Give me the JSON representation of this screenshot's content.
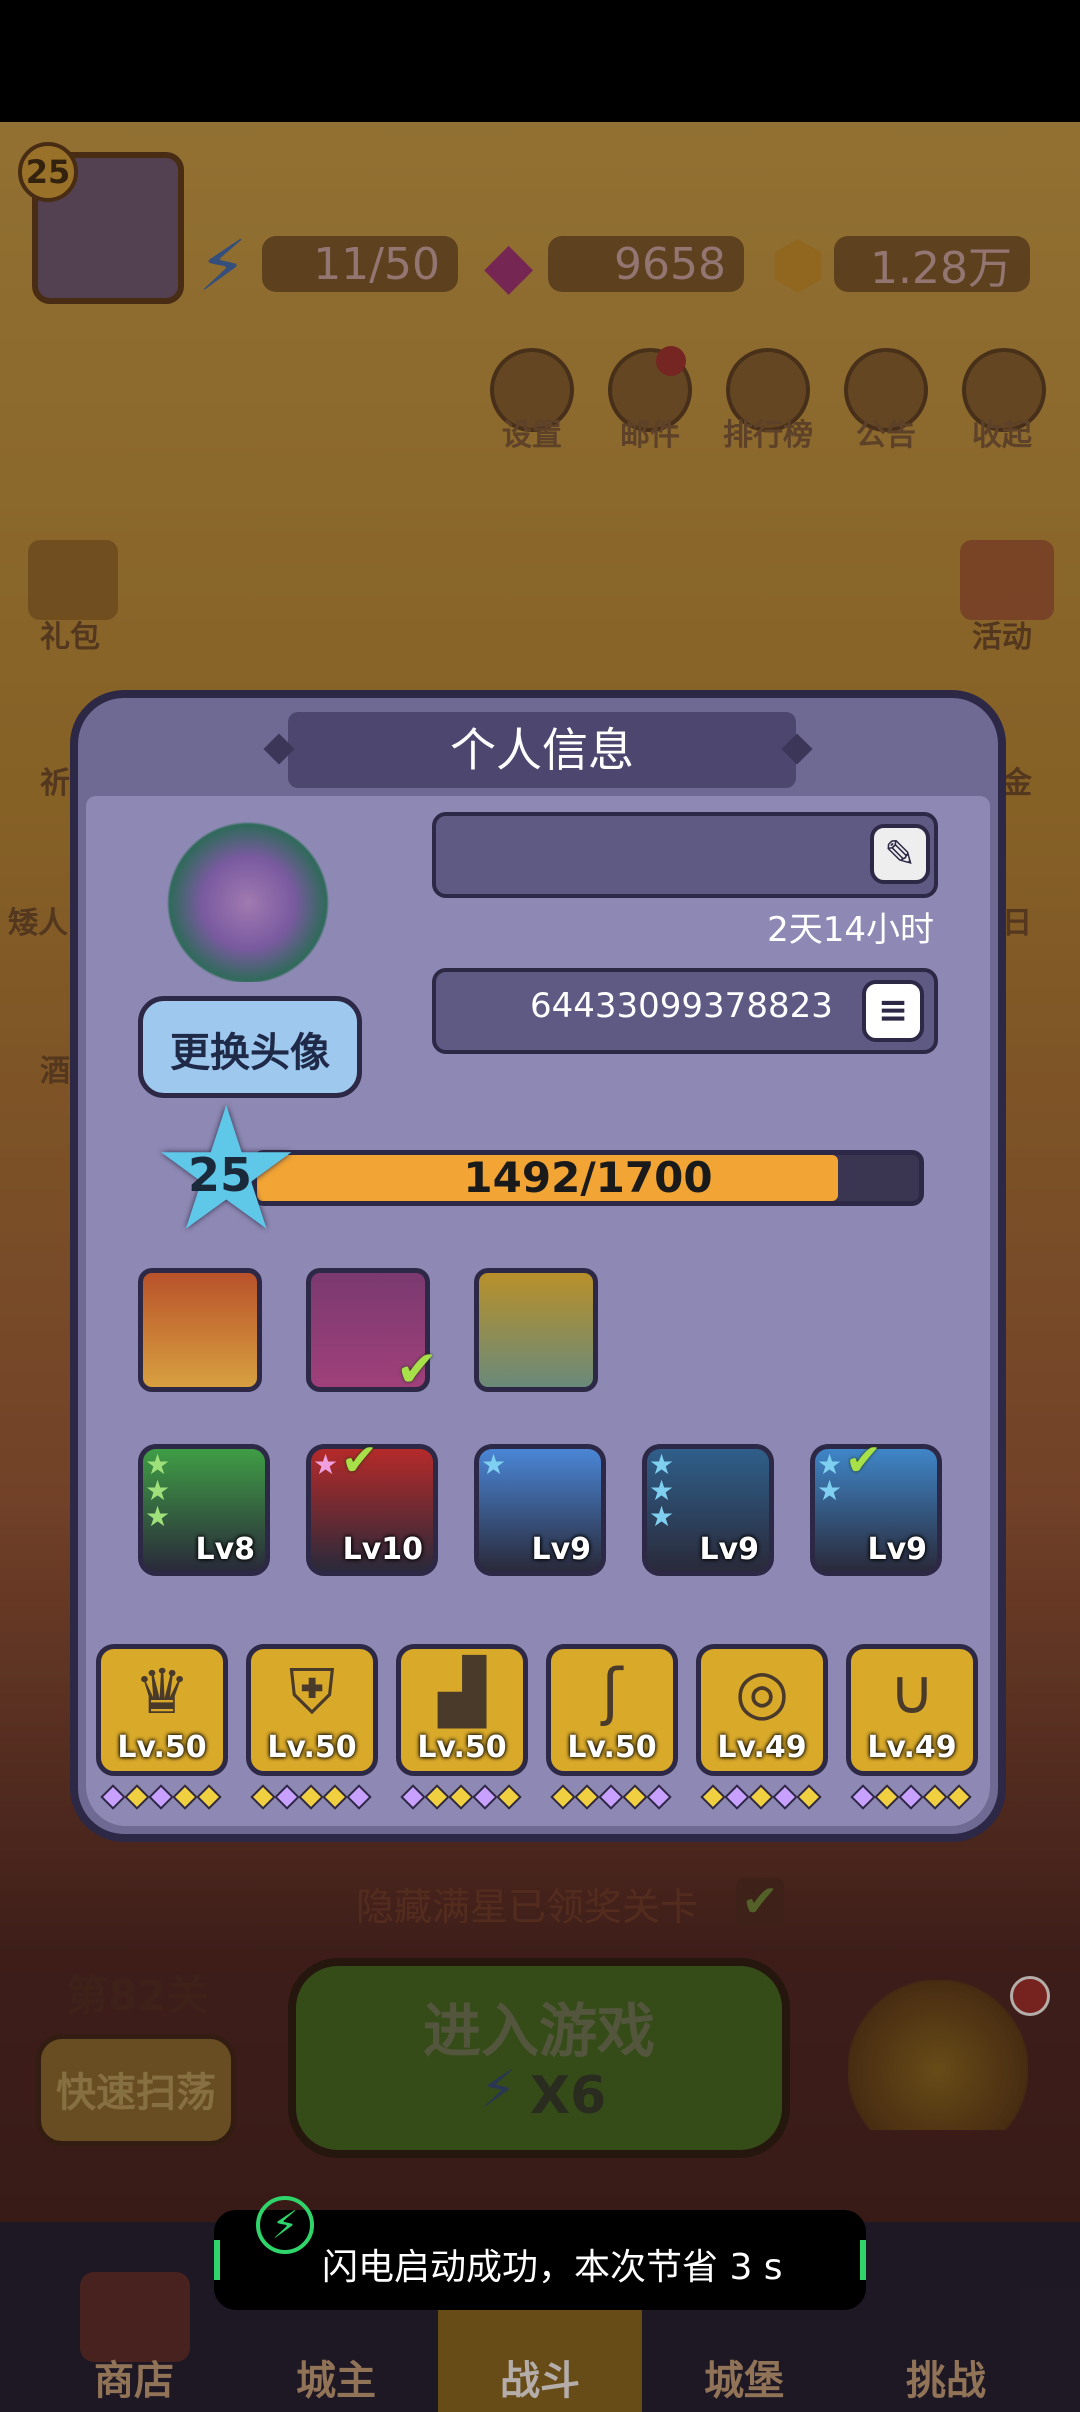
{
  "header": {
    "level": "25",
    "energy": "11/50",
    "gems": "9658",
    "gold": "1.28万"
  },
  "top_icons": [
    {
      "label": "设置",
      "icon": "gear-icon"
    },
    {
      "label": "邮件",
      "icon": "mail-icon"
    },
    {
      "label": "排行榜",
      "icon": "leaderboard-icon"
    },
    {
      "label": "公告",
      "icon": "megaphone-icon"
    },
    {
      "label": "收起",
      "icon": "play-icon"
    }
  ],
  "side_left": [
    "礼包",
    "祈",
    "矮人",
    "酒"
  ],
  "side_right": [
    "活动",
    "金",
    "日"
  ],
  "modal": {
    "title": "个人信息",
    "name_value": "",
    "time_text": "2天14小时",
    "id_value": "64433099378823",
    "change_avatar_label": "更换头像",
    "level": "25",
    "xp_text": "1492/1700",
    "xp_fraction": 0.878,
    "portraits": [
      {
        "name": "blonde-hero",
        "selected": false
      },
      {
        "name": "red-hair-hero",
        "selected": true
      },
      {
        "name": "elf-hero",
        "selected": false
      }
    ],
    "pets": [
      {
        "lv": "Lv8",
        "stars": 3,
        "checked": false,
        "color": "#3f9d45"
      },
      {
        "lv": "Lv10",
        "stars": 1,
        "checked": true,
        "color": "#b52a2a"
      },
      {
        "lv": "Lv9",
        "stars": 1,
        "checked": false,
        "color": "#4a86d6"
      },
      {
        "lv": "Lv9",
        "stars": 3,
        "checked": false,
        "color": "#2f5f8a"
      },
      {
        "lv": "Lv9",
        "stars": 2,
        "checked": true,
        "color": "#3f86c8"
      }
    ],
    "equipment": [
      {
        "lv": "Lv.50",
        "icon": "crown-icon"
      },
      {
        "lv": "Lv.50",
        "icon": "armor-icon"
      },
      {
        "lv": "Lv.50",
        "icon": "boot-icon"
      },
      {
        "lv": "Lv.50",
        "icon": "staff-icon"
      },
      {
        "lv": "Lv.49",
        "icon": "ring-icon"
      },
      {
        "lv": "Lv.49",
        "icon": "necklace-icon"
      }
    ]
  },
  "below": {
    "hidden_label": "隐藏满星已领奖关卡",
    "stage": "第82关",
    "sweep_label": "快速扫荡",
    "enter_label": "进入游戏",
    "enter_cost": "X6"
  },
  "nav": [
    "商店",
    "城主",
    "战斗",
    "城堡",
    "挑战"
  ],
  "toast": "闪电启动成功，本次节省 3 s"
}
